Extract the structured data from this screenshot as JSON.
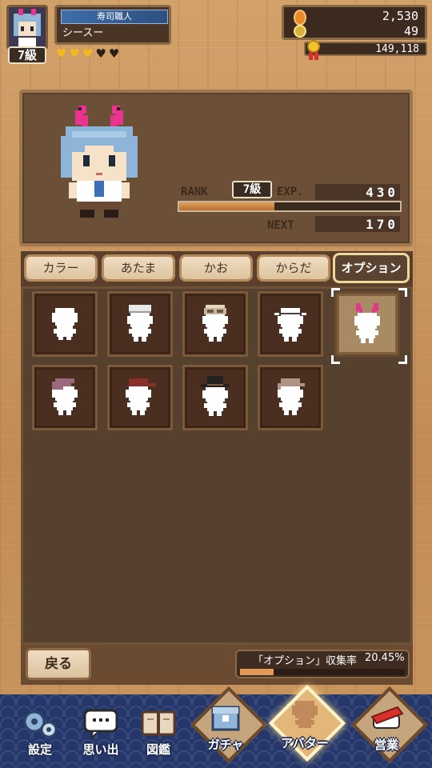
{
  "header": {
    "level_badge": "7級",
    "title_label": "寿司職人",
    "player_name": "シースー",
    "hearts": [
      "♥",
      "♥",
      "♥",
      "♥",
      "♥"
    ],
    "hearts_filled": 3,
    "currency": {
      "coins": "2,530",
      "gold": "49",
      "medals": "149,118"
    }
  },
  "preview": {
    "rank_label": "RANK",
    "rank_value": "7級",
    "exp_label": "EXP.",
    "exp_value": "430",
    "exp_progress": 0.43,
    "next_label": "NEXT",
    "next_value": "170"
  },
  "tabs": [
    {
      "label": "カラー"
    },
    {
      "label": "あたま"
    },
    {
      "label": "かお"
    },
    {
      "label": "からだ"
    },
    {
      "label": "オプション",
      "active": true
    }
  ],
  "items": [
    {
      "icon": "blank-figure-icon"
    },
    {
      "icon": "white-cap-figure-icon"
    },
    {
      "icon": "goggles-figure-icon"
    },
    {
      "icon": "headband-figure-icon"
    },
    {
      "icon": "bunny-ribbon-figure-icon",
      "selected": true
    },
    {
      "icon": "beret-figure-icon"
    },
    {
      "icon": "red-cap-figure-icon"
    },
    {
      "icon": "top-hat-figure-icon"
    },
    {
      "icon": "hunting-cap-figure-icon"
    }
  ],
  "footer": {
    "back_label": "戻る",
    "collect_label": "「オプション」収集率",
    "collect_rate": "20.45%",
    "collect_progress": 0.2045
  },
  "nav": [
    {
      "label": "設定",
      "icon": "gears-icon"
    },
    {
      "label": "思い出",
      "icon": "chat-bubble-icon"
    },
    {
      "label": "図鑑",
      "icon": "book-icon"
    },
    {
      "label": "ガチャ",
      "icon": "gacha-box-icon"
    },
    {
      "label": "アバター",
      "icon": "avatar-icon",
      "active": true
    },
    {
      "label": "営業",
      "icon": "sushi-icon"
    }
  ],
  "colors": {
    "wood": "#c8945c",
    "panel_dark": "#56412f",
    "exp_fill": "#c07432",
    "accent_pink": "#e8338f",
    "hair_blue": "#8db5d8",
    "nav_blue": "#24366a"
  }
}
